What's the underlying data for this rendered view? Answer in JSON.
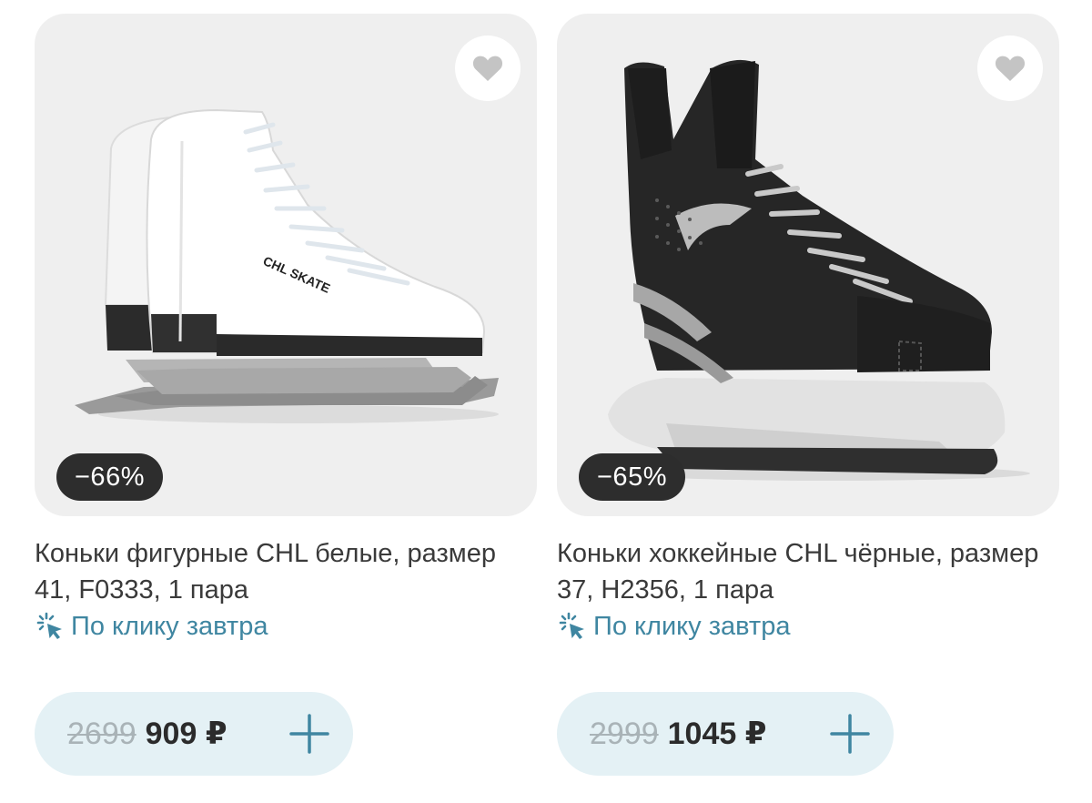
{
  "products": [
    {
      "title": "Коньки фигурные CHL белые, размер 41, F0333, 1 пара",
      "discount": "−66%",
      "delivery": "По клику завтра",
      "old_price": "2699",
      "price": "909 ₽",
      "image_text": "CHL SKATE",
      "favorite_icon": "heart-icon",
      "add_icon": "plus-icon"
    },
    {
      "title": "Коньки хоккейные CHL чёрные, размер 37, H2356, 1 пара",
      "discount": "−65%",
      "delivery": "По клику завтра",
      "old_price": "2999",
      "price": "1045 ₽",
      "favorite_icon": "heart-icon",
      "add_icon": "plus-icon"
    }
  ],
  "colors": {
    "card_bg": "#efefef",
    "accent": "#3f86a1",
    "price_pill": "#e4f1f5",
    "badge": "#2d2d2d"
  }
}
